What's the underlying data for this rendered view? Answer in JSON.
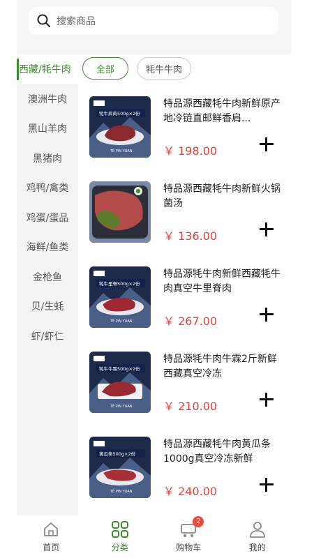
{
  "search": {
    "placeholder": "搜索商品"
  },
  "sidebar": {
    "items": [
      {
        "label": "西藏/牦牛肉",
        "active": true
      },
      {
        "label": "澳洲牛肉"
      },
      {
        "label": "黑山羊肉"
      },
      {
        "label": "黑猪肉"
      },
      {
        "label": "鸡鸭/禽类"
      },
      {
        "label": "鸡蛋/蛋品"
      },
      {
        "label": "海鲜/鱼类"
      },
      {
        "label": "金枪鱼"
      },
      {
        "label": "贝/生蚝"
      },
      {
        "label": "虾/虾仁"
      }
    ]
  },
  "chips": [
    {
      "label": "全部",
      "active": true
    },
    {
      "label": "牦牛牛肉",
      "active": false
    }
  ],
  "products": [
    {
      "title": "特品源西藏牦牛肉新鲜原产地冷链直邮鲜香肩...",
      "price": "￥ 198.00",
      "pack_label": "牦牛肩肉500g×2份",
      "brand": "TÈ PIN YUAN"
    },
    {
      "title": "特品源西藏牦牛肉新鲜火锅菌汤",
      "price": "￥ 136.00"
    },
    {
      "title": "特品源牦牛肉新鲜西藏牦牛肉真空牛里脊肉",
      "price": "￥ 267.00",
      "pack_label": "牦牛里脊500g×2份",
      "brand": "TÈ PIN YUAN"
    },
    {
      "title": "特品源牦牛肉牛霖2斤新鲜西藏真空冷冻",
      "price": "￥ 210.00",
      "pack_label": "牦牛牛霖500g×2份",
      "brand": "TÈ PIN YUAN"
    },
    {
      "title": "特品源西藏牦牛肉黄瓜条1000g真空冷冻新鲜",
      "price": "￥ 240.00",
      "pack_label": "黄瓜条500g×2份",
      "brand": "TÈ PIN YUAN"
    }
  ],
  "nav": {
    "items": [
      {
        "label": "首页",
        "icon": "home-icon"
      },
      {
        "label": "分类",
        "icon": "category-icon",
        "active": true
      },
      {
        "label": "购物车",
        "icon": "cart-icon",
        "badge": "2"
      },
      {
        "label": "我的",
        "icon": "user-icon"
      }
    ]
  },
  "colors": {
    "accent": "#3d8b2f",
    "price": "#e0413a",
    "badge": "#e94a3e",
    "thumb_bg": "#1d2a4a"
  }
}
